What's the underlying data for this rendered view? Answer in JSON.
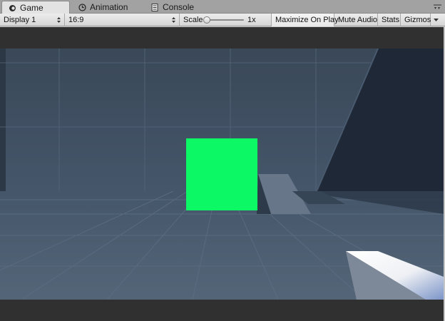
{
  "tabs": [
    {
      "label": "Game",
      "icon": "game-controller-icon",
      "active": true
    },
    {
      "label": "Animation",
      "icon": "clock-icon",
      "active": false
    },
    {
      "label": "Console",
      "icon": "console-icon",
      "active": false
    }
  ],
  "toolbar": {
    "display_select": "Display 1",
    "aspect_select": "16:9",
    "scale_label": "Scale",
    "scale_value": "1x",
    "scale_slider_level": 0.0,
    "maximize_on_play": "Maximize On Play",
    "mute_audio": "Mute Audio",
    "stats": "Stats",
    "gizmos": "Gizmos"
  },
  "scene": {
    "sky_color": "#3c4b5b",
    "floor_color": "#4a5b6d",
    "cube_color": "#0cf865",
    "grid_color": "#5d6d80"
  }
}
